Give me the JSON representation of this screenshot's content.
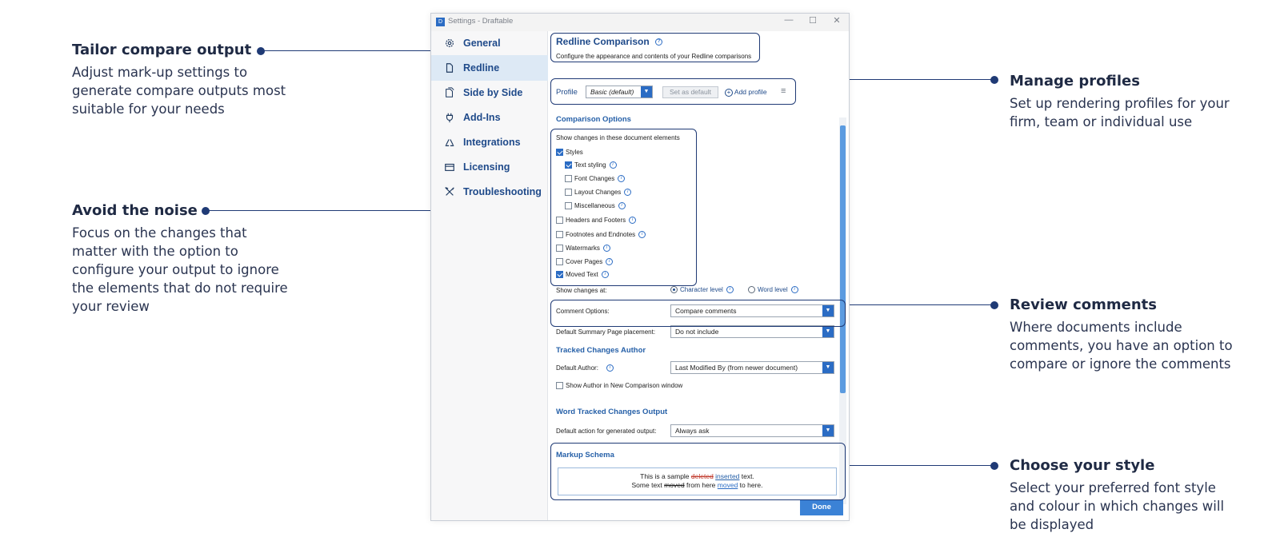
{
  "accent_color": "#1f3a75",
  "callouts": {
    "tailor": {
      "title": "Tailor compare output",
      "body": "Adjust mark-up settings to generate compare outputs most suitable for your needs"
    },
    "noise": {
      "title": "Avoid the noise",
      "body": "Focus on the changes that matter with the option to configure your output to ignore the elements that do not require your review"
    },
    "profiles": {
      "title": "Manage profiles",
      "body": "Set up rendering profiles for your firm, team or individual use"
    },
    "comments": {
      "title": "Review comments",
      "body": "Where documents include comments, you have an option to compare or ignore the comments"
    },
    "style": {
      "title": "Choose your style",
      "body": "Select your preferred font style and colour in which changes will be displayed"
    }
  },
  "window": {
    "title": "Settings - Draftable",
    "controls": [
      "—",
      "☐",
      "✕"
    ]
  },
  "sidebar": {
    "items": [
      {
        "label": "General",
        "icon": "gear-icon"
      },
      {
        "label": "Redline",
        "icon": "document-icon",
        "active": true
      },
      {
        "label": "Side by Side",
        "icon": "documents-icon"
      },
      {
        "label": "Add-Ins",
        "icon": "plug-icon"
      },
      {
        "label": "Integrations",
        "icon": "integrations-icon"
      },
      {
        "label": "Licensing",
        "icon": "card-icon"
      },
      {
        "label": "Troubleshooting",
        "icon": "tools-icon"
      }
    ]
  },
  "redline": {
    "title": "Redline Comparison",
    "subtitle": "Configure the appearance and contents of your Redline comparisons",
    "profile_label": "Profile",
    "profile_value": "Basic (default)",
    "set_default": "Set as default",
    "add_profile": "Add profile",
    "comparison_options": "Comparison Options",
    "show_changes_in": "Show changes in these document elements",
    "elements": [
      {
        "label": "Styles",
        "checked": true,
        "indent": 0,
        "info": false
      },
      {
        "label": "Text styling",
        "checked": true,
        "indent": 1,
        "info": true
      },
      {
        "label": "Font Changes",
        "checked": false,
        "indent": 1,
        "info": true
      },
      {
        "label": "Layout Changes",
        "checked": false,
        "indent": 1,
        "info": true
      },
      {
        "label": "Miscellaneous",
        "checked": false,
        "indent": 1,
        "info": true
      },
      {
        "label": "Headers and Footers",
        "checked": false,
        "indent": 0,
        "info": true
      },
      {
        "label": "Footnotes and Endnotes",
        "checked": false,
        "indent": 0,
        "info": true
      },
      {
        "label": "Watermarks",
        "checked": false,
        "indent": 0,
        "info": true
      },
      {
        "label": "Cover Pages",
        "checked": false,
        "indent": 0,
        "info": true
      },
      {
        "label": "Moved Text",
        "checked": true,
        "indent": 0,
        "info": true
      }
    ],
    "show_changes_at": "Show changes at:",
    "character_level": "Character level",
    "word_level": "Word level",
    "comment_options_label": "Comment Options:",
    "comment_options_value": "Compare comments",
    "summary_label": "Default Summary Page placement:",
    "summary_value": "Do not include",
    "tracked_author_title": "Tracked Changes Author",
    "default_author_label": "Default Author:",
    "default_author_value": "Last Modified By (from newer document)",
    "show_author_label": "Show Author in New Comparison window",
    "word_tracked_title": "Word Tracked Changes Output",
    "default_action_label": "Default action for generated output:",
    "default_action_value": "Always ask",
    "markup_schema_title": "Markup Schema",
    "schema": {
      "l1_a": "This is a sample ",
      "l1_del": "deleted",
      "l1_b": " ",
      "l1_ins": "inserted",
      "l1_c": " text.",
      "l2_a": "Some text ",
      "l2_from": "moved",
      "l2_b": " from here ",
      "l2_to": "moved",
      "l2_c": " to here."
    },
    "done": "Done"
  }
}
